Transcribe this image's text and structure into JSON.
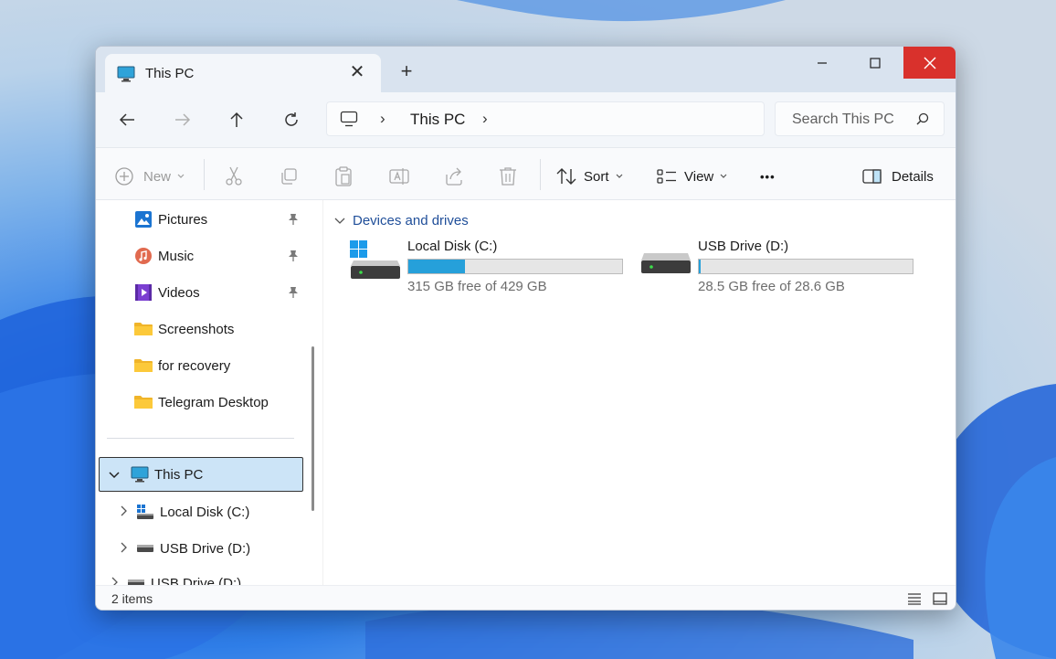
{
  "window": {
    "tab_title": "This PC",
    "tab_close": "✕",
    "new_tab": "+"
  },
  "address": {
    "crumb": "This PC",
    "chevron": "›"
  },
  "search": {
    "placeholder": "Search This PC"
  },
  "commands": {
    "new_label": "New",
    "sort_label": "Sort",
    "view_label": "View",
    "more_label": "•••",
    "details_label": "Details"
  },
  "navpane": {
    "quick_access": [
      {
        "label": "Pictures",
        "icon": "pictures-icon",
        "pinned": true
      },
      {
        "label": "Music",
        "icon": "music-icon",
        "pinned": true
      },
      {
        "label": "Videos",
        "icon": "videos-icon",
        "pinned": true
      },
      {
        "label": "Screenshots",
        "icon": "folder-icon",
        "pinned": false
      },
      {
        "label": "for recovery",
        "icon": "folder-icon",
        "pinned": false
      },
      {
        "label": "Telegram Desktop",
        "icon": "folder-icon",
        "pinned": false
      }
    ],
    "this_pc": "This PC",
    "drives": [
      {
        "label": "Local Disk (C:)",
        "icon": "system-drive-icon"
      },
      {
        "label": "USB Drive (D:)",
        "icon": "usb-drive-icon"
      },
      {
        "label": "USB Drive (D:)",
        "icon": "usb-drive-icon"
      }
    ]
  },
  "content": {
    "group_header": "Devices and drives",
    "drives": [
      {
        "name": "Local Disk (C:)",
        "free_text": "315 GB free of 429 GB",
        "used_fraction": 0.266
      },
      {
        "name": "USB Drive (D:)",
        "free_text": "28.5 GB free of 28.6 GB",
        "used_fraction": 0.004
      }
    ]
  },
  "status": {
    "item_count": "2 items"
  },
  "colors": {
    "accent": "#26a0da",
    "close_red": "#d9312c",
    "selected_bg": "#cce4f7",
    "group_header": "#1f4e99"
  }
}
